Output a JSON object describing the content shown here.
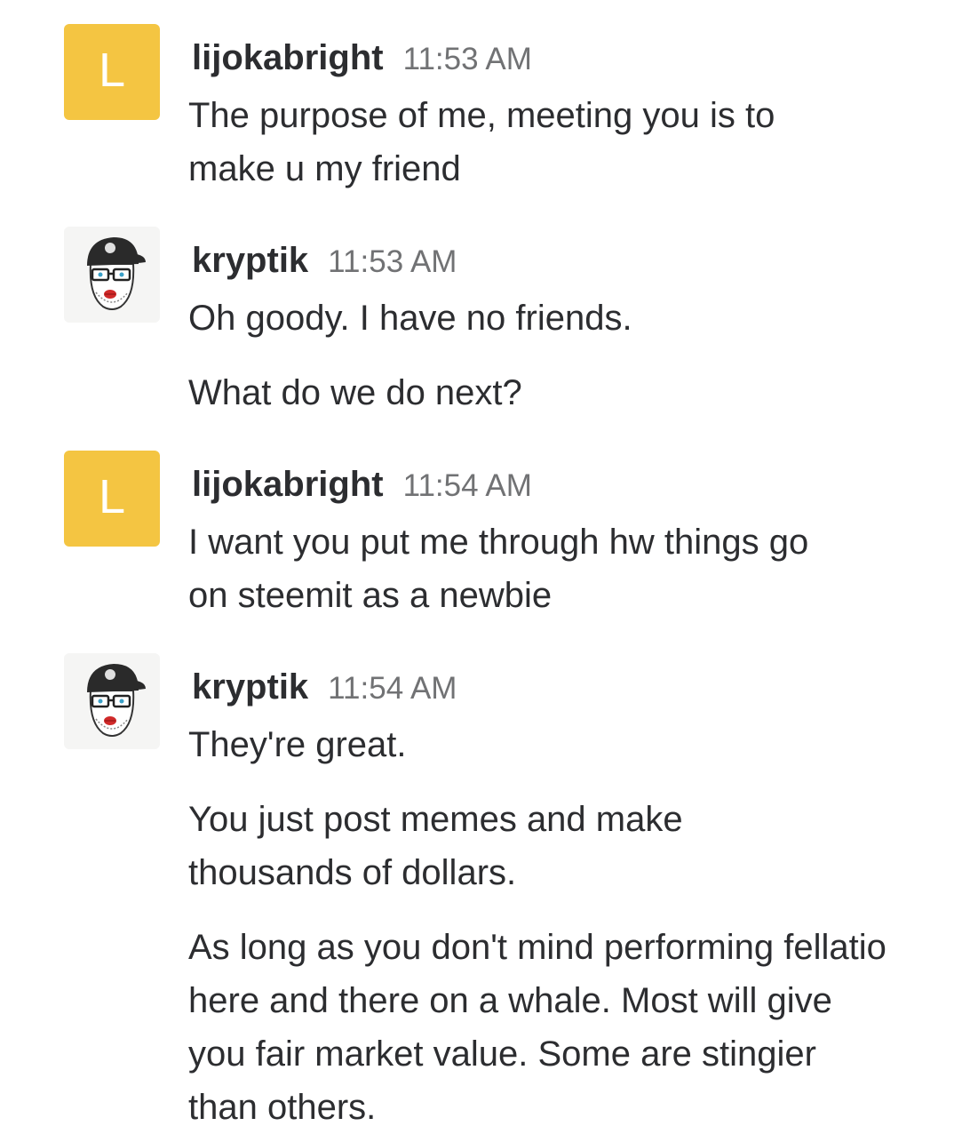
{
  "colors": {
    "avatar_letter_bg": "#f4c542",
    "username": "#2c2d30",
    "timestamp": "#717274",
    "text": "#2c2d30"
  },
  "messages": [
    {
      "avatar": {
        "type": "letter",
        "letter": "L"
      },
      "username": "lijokabright",
      "time": "11:53 AM",
      "paragraphs": [
        "The purpose of me, meeting you is to make u my friend"
      ]
    },
    {
      "avatar": {
        "type": "photo",
        "icon": "user-avatar-icon"
      },
      "username": "kryptik",
      "time": "11:53 AM",
      "paragraphs": [
        "Oh goody. I have no friends.",
        "What do we do next?"
      ]
    },
    {
      "avatar": {
        "type": "letter",
        "letter": "L"
      },
      "username": "lijokabright",
      "time": "11:54 AM",
      "paragraphs": [
        "I want you put me through hw things go on steemit as a newbie"
      ]
    },
    {
      "avatar": {
        "type": "photo",
        "icon": "user-avatar-icon"
      },
      "username": "kryptik",
      "time": "11:54 AM",
      "paragraphs": [
        "They're great.",
        "You just post memes and make thousands of dollars.",
        "As long as you don't mind performing fellatio here and there on a whale. Most will give you fair market value. Some are stingier than others."
      ]
    }
  ]
}
